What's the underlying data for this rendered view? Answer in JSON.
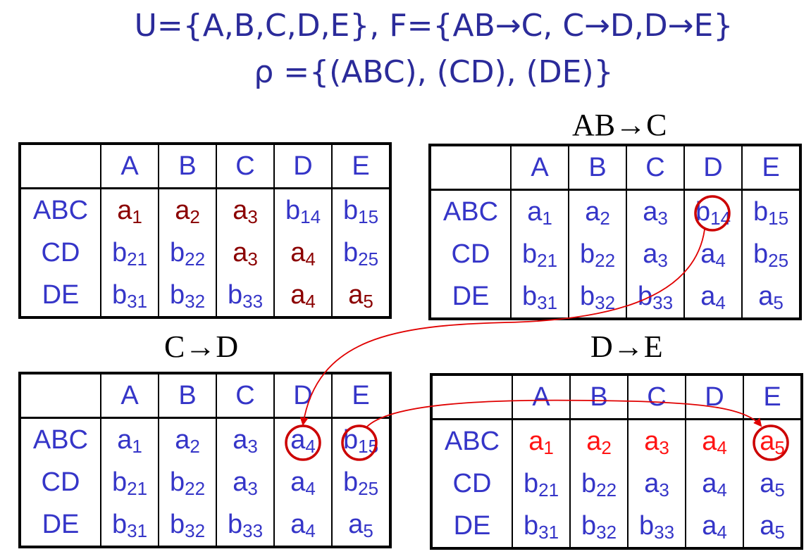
{
  "heading": {
    "line1": "U={A,B,C,D,E}, F={AB→C, C→D,D→E}",
    "line2": "ρ ={(ABC), (CD), (DE)}"
  },
  "tables": [
    {
      "title": "",
      "columns": [
        "A",
        "B",
        "C",
        "D",
        "E"
      ],
      "rows": [
        {
          "label": "ABC",
          "cells": [
            [
              "a",
              "1"
            ],
            [
              "a",
              "2"
            ],
            [
              "a",
              "3"
            ],
            [
              "b",
              "14"
            ],
            [
              "b",
              "15"
            ]
          ]
        },
        {
          "label": "CD",
          "cells": [
            [
              "b",
              "21"
            ],
            [
              "b",
              "22"
            ],
            [
              "a",
              "3"
            ],
            [
              "a",
              "4"
            ],
            [
              "b",
              "25"
            ]
          ]
        },
        {
          "label": "DE",
          "cells": [
            [
              "b",
              "31"
            ],
            [
              "b",
              "32"
            ],
            [
              "b",
              "33"
            ],
            [
              "a",
              "4"
            ],
            [
              "a",
              "5"
            ]
          ]
        }
      ]
    },
    {
      "title": "AB→C",
      "columns": [
        "A",
        "B",
        "C",
        "D",
        "E"
      ],
      "rows": [
        {
          "label": "ABC",
          "cells": [
            [
              "a",
              "1"
            ],
            [
              "a",
              "2"
            ],
            [
              "a",
              "3"
            ],
            [
              "b",
              "14"
            ],
            [
              "b",
              "15"
            ]
          ]
        },
        {
          "label": "CD",
          "cells": [
            [
              "b",
              "21"
            ],
            [
              "b",
              "22"
            ],
            [
              "a",
              "3"
            ],
            [
              "a",
              "4"
            ],
            [
              "b",
              "25"
            ]
          ]
        },
        {
          "label": "DE",
          "cells": [
            [
              "b",
              "31"
            ],
            [
              "b",
              "32"
            ],
            [
              "b",
              "33"
            ],
            [
              "a",
              "4"
            ],
            [
              "a",
              "5"
            ]
          ]
        }
      ]
    },
    {
      "title": "C→D",
      "columns": [
        "A",
        "B",
        "C",
        "D",
        "E"
      ],
      "rows": [
        {
          "label": "ABC",
          "cells": [
            [
              "a",
              "1"
            ],
            [
              "a",
              "2"
            ],
            [
              "a",
              "3"
            ],
            [
              "a",
              "4"
            ],
            [
              "b",
              "15"
            ]
          ]
        },
        {
          "label": "CD",
          "cells": [
            [
              "b",
              "21"
            ],
            [
              "b",
              "22"
            ],
            [
              "a",
              "3"
            ],
            [
              "a",
              "4"
            ],
            [
              "b",
              "25"
            ]
          ]
        },
        {
          "label": "DE",
          "cells": [
            [
              "b",
              "31"
            ],
            [
              "b",
              "32"
            ],
            [
              "b",
              "33"
            ],
            [
              "a",
              "4"
            ],
            [
              "a",
              "5"
            ]
          ]
        }
      ]
    },
    {
      "title": "D→E",
      "columns": [
        "A",
        "B",
        "C",
        "D",
        "E"
      ],
      "rows": [
        {
          "label": "ABC",
          "cells": [
            [
              "a",
              "1"
            ],
            [
              "a",
              "2"
            ],
            [
              "a",
              "3"
            ],
            [
              "a",
              "4"
            ],
            [
              "a",
              "5"
            ]
          ]
        },
        {
          "label": "CD",
          "cells": [
            [
              "b",
              "21"
            ],
            [
              "b",
              "22"
            ],
            [
              "a",
              "3"
            ],
            [
              "a",
              "4"
            ],
            [
              "a",
              "5"
            ]
          ]
        },
        {
          "label": "DE",
          "cells": [
            [
              "b",
              "31"
            ],
            [
              "b",
              "32"
            ],
            [
              "b",
              "33"
            ],
            [
              "a",
              "4"
            ],
            [
              "a",
              "5"
            ]
          ]
        }
      ]
    }
  ],
  "colors": {
    "text_blue": "#3535c8",
    "initial_a_dark_red": "#8b0000",
    "final_row_red": "#ff1414",
    "highlight_circle": "#cc0000",
    "arrow": "#e00000"
  }
}
